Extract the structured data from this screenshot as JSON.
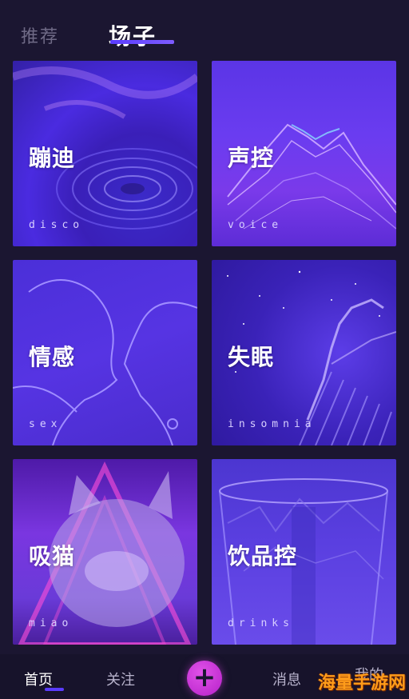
{
  "top_tabs": [
    {
      "label": "推荐"
    },
    {
      "label": "场子"
    }
  ],
  "cards": [
    {
      "title": "蹦迪",
      "subtitle": "disco"
    },
    {
      "title": "声控",
      "subtitle": "voice"
    },
    {
      "title": "情感",
      "subtitle": "sex"
    },
    {
      "title": "失眠",
      "subtitle": "insomnia"
    },
    {
      "title": "吸猫",
      "subtitle": "miao"
    },
    {
      "title": "饮品控",
      "subtitle": "drinks"
    }
  ],
  "bottom_nav": {
    "home": "首页",
    "follow": "关注",
    "add": "+",
    "messages": "消息",
    "me": "我的"
  },
  "watermark": "海量手游网",
  "colors": {
    "accent": "#5a3cff",
    "plus": "#c62fd6",
    "background": "#1b1631"
  }
}
